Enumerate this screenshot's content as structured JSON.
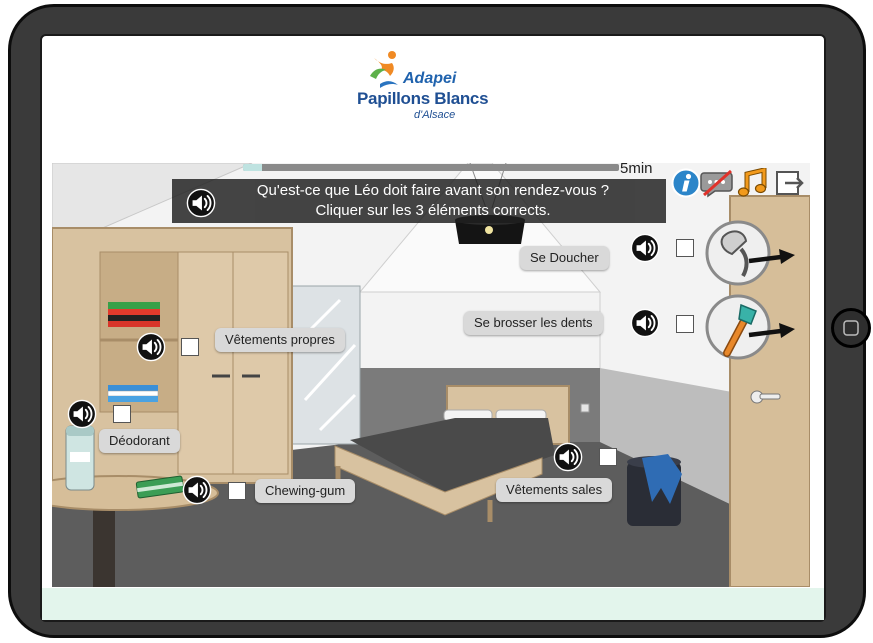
{
  "logo": {
    "brand": "Adapei",
    "name": "Papillons Blancs",
    "region": "d'Alsace",
    "icon": "butterfly-figure-logo-icon"
  },
  "timer": {
    "label": "5min",
    "progress": 0.05
  },
  "toolbar": [
    {
      "icon": "info-icon"
    },
    {
      "icon": "speech-off-icon"
    },
    {
      "icon": "music-icon"
    },
    {
      "icon": "exit-icon"
    }
  ],
  "question": {
    "line1": "Qu'est-ce que Léo doit faire avant son rendez-vous ?",
    "line2": "Cliquer sur les 3 éléments corrects.",
    "audio_icon": "speaker-icon"
  },
  "choices": [
    {
      "label": "Se Doucher",
      "checked": false,
      "audio_icon": "speaker-icon",
      "picture": "shower-icon"
    },
    {
      "label": "Se brosser les dents",
      "checked": false,
      "audio_icon": "speaker-icon",
      "picture": "toothbrush-icon"
    },
    {
      "label": "Vêtements propres",
      "checked": false,
      "audio_icon": "speaker-icon"
    },
    {
      "label": "Déodorant",
      "checked": false,
      "audio_icon": "speaker-icon"
    },
    {
      "label": "Chewing-gum",
      "checked": false,
      "audio_icon": "speaker-icon"
    },
    {
      "label": "Vêtements sales",
      "checked": false,
      "audio_icon": "speaker-icon"
    }
  ],
  "colors": {
    "accent": "#2b85c9",
    "music": "#f29a1c",
    "banner": "rgba(28,28,28,.88)",
    "label": "#d9d9d9",
    "strip": "#e3f5ec",
    "bezel": "#3a3a3a"
  }
}
